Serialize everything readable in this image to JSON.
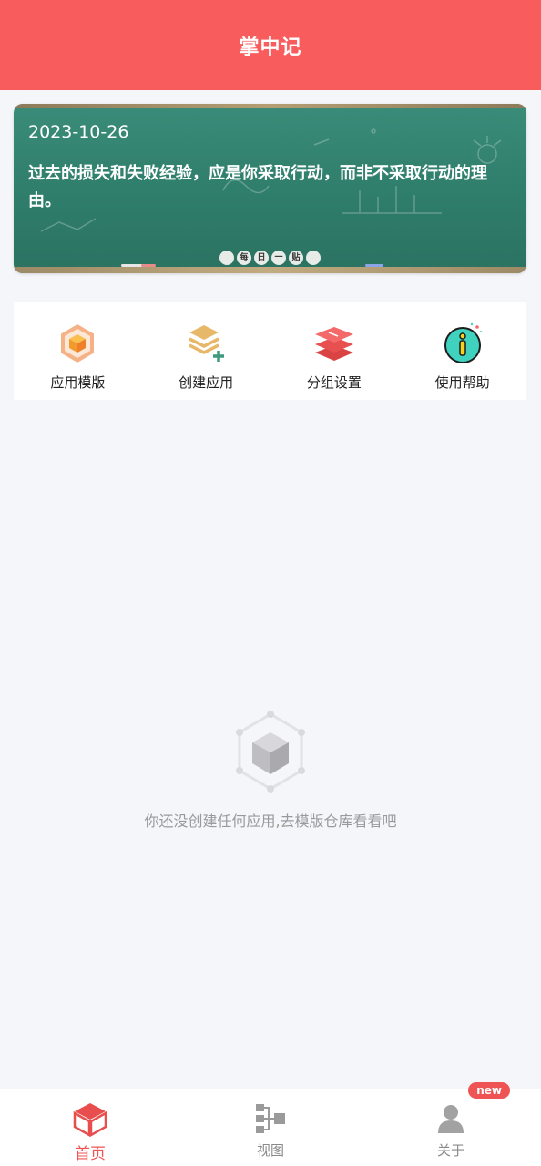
{
  "header": {
    "title": "掌中记"
  },
  "banner": {
    "date": "2023-10-26",
    "quote": "过去的损失和失败经验，应是你采取行动，而非不采取行动的理由。",
    "dots": [
      "",
      "每",
      "日",
      "一",
      "贴",
      ""
    ]
  },
  "quick_actions": [
    {
      "label": "应用模版",
      "icon": "app-template-icon"
    },
    {
      "label": "创建应用",
      "icon": "create-app-icon"
    },
    {
      "label": "分组设置",
      "icon": "group-settings-icon"
    },
    {
      "label": "使用帮助",
      "icon": "help-icon"
    }
  ],
  "empty_state": {
    "text": "你还没创建任何应用,去模版仓库看看吧",
    "icon": "empty-box-icon"
  },
  "tabbar": {
    "tabs": [
      {
        "label": "首页",
        "icon": "home-box-icon",
        "active": true
      },
      {
        "label": "视图",
        "icon": "view-tree-icon",
        "active": false
      },
      {
        "label": "关于",
        "icon": "person-icon",
        "active": false,
        "badge": "new"
      }
    ]
  },
  "colors": {
    "accent": "#f95c5c",
    "background": "#f5f6fa",
    "chalkboard": "#2f7d6b",
    "muted_text": "#9a9a9a"
  }
}
